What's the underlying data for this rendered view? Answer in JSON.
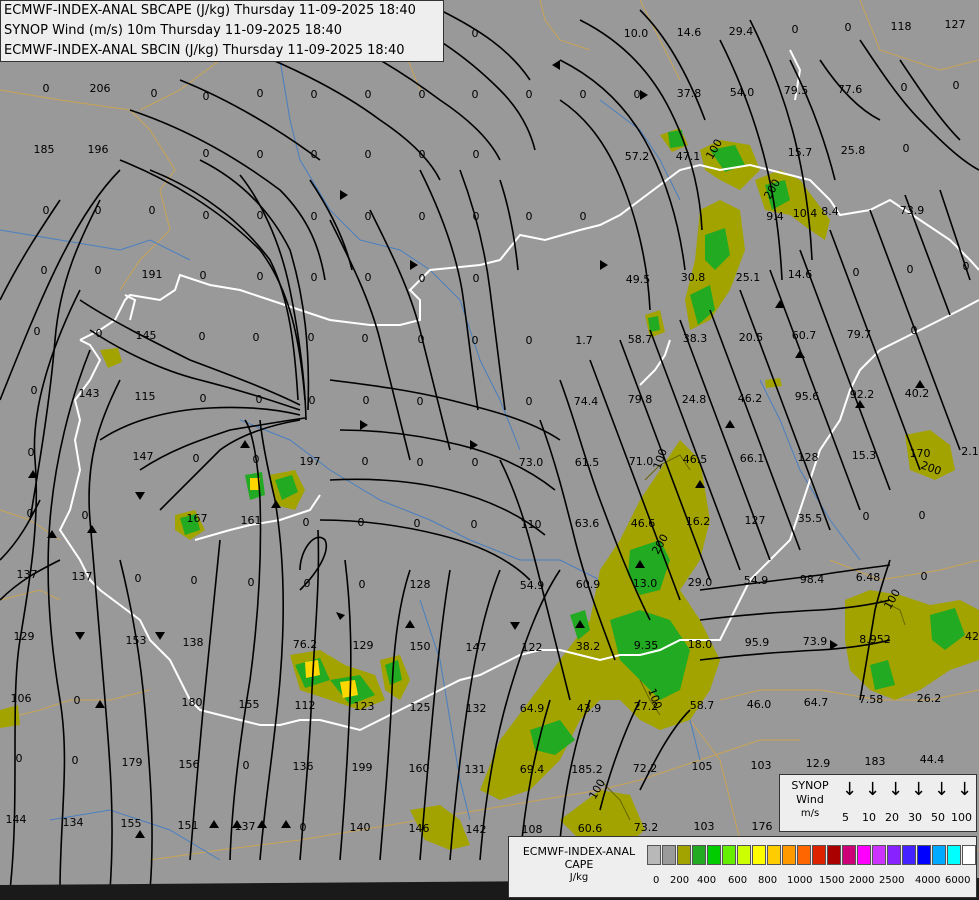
{
  "header": {
    "line1": "ECMWF-INDEX-ANAL SBCAPE (J/kg) Thursday 11-09-2025 18:40",
    "line2": "SYNOP Wind (m/s) 10m Thursday 11-09-2025 18:40",
    "line3": "ECMWF-INDEX-ANAL SBCIN (J/kg) Thursday 11-09-2025 18:40"
  },
  "colors": {
    "background": "#999999",
    "border": "#ffffff",
    "river": "#4a7fc0",
    "region_line": "#c9a455",
    "streamline": "#000000",
    "cape_low": "#a3a300",
    "cape_mid": "#22aa22",
    "cape_high": "#ffd700"
  },
  "values": [
    {
      "v": "0"
    },
    {
      "v": "206"
    },
    {
      "v": "0"
    },
    {
      "v": "0"
    },
    {
      "v": "0"
    },
    {
      "v": "0"
    },
    {
      "v": "0"
    },
    {
      "v": "0"
    },
    {
      "v": "0"
    },
    {
      "v": "0"
    },
    {
      "v": "0"
    },
    {
      "v": "0"
    },
    {
      "v": "185"
    },
    {
      "v": "196"
    },
    {
      "v": "0"
    },
    {
      "v": "0"
    },
    {
      "v": "0"
    },
    {
      "v": "0"
    },
    {
      "v": "0"
    },
    {
      "v": "0"
    },
    {
      "v": "57.2"
    },
    {
      "v": "47.1"
    },
    {
      "v": "15.7"
    },
    {
      "v": "25.8"
    },
    {
      "v": "0"
    },
    {
      "v": "0"
    },
    {
      "v": "0"
    },
    {
      "v": "0"
    },
    {
      "v": "0"
    },
    {
      "v": "0"
    },
    {
      "v": "0"
    },
    {
      "v": "0"
    },
    {
      "v": "0"
    },
    {
      "v": "0"
    },
    {
      "v": "0"
    },
    {
      "v": "0"
    },
    {
      "v": "8.4"
    },
    {
      "v": "10.4"
    },
    {
      "v": "9.4"
    },
    {
      "v": "73.9"
    },
    {
      "v": "0"
    },
    {
      "v": "0"
    },
    {
      "v": "191"
    },
    {
      "v": "0"
    },
    {
      "v": "0"
    },
    {
      "v": "0"
    },
    {
      "v": "0"
    },
    {
      "v": "0"
    },
    {
      "v": "0"
    },
    {
      "v": "49.5"
    },
    {
      "v": "30.8"
    },
    {
      "v": "25.1"
    },
    {
      "v": "14.6"
    },
    {
      "v": "0"
    },
    {
      "v": "0"
    },
    {
      "v": "0"
    },
    {
      "v": "0"
    },
    {
      "v": "0"
    },
    {
      "v": "145"
    },
    {
      "v": "0"
    },
    {
      "v": "0"
    },
    {
      "v": "0"
    },
    {
      "v": "0"
    },
    {
      "v": "0"
    },
    {
      "v": "0"
    },
    {
      "v": "0"
    },
    {
      "v": "1.7"
    },
    {
      "v": "58.7"
    },
    {
      "v": "38.3"
    },
    {
      "v": "20.5"
    },
    {
      "v": "60.7"
    },
    {
      "v": "79.7"
    },
    {
      "v": "0"
    },
    {
      "v": "0"
    },
    {
      "v": "143"
    },
    {
      "v": "115"
    },
    {
      "v": "0"
    },
    {
      "v": "0"
    },
    {
      "v": "0"
    },
    {
      "v": "0"
    },
    {
      "v": "0"
    },
    {
      "v": "0"
    },
    {
      "v": "74.4"
    },
    {
      "v": "79.8"
    },
    {
      "v": "24.8"
    },
    {
      "v": "46.2"
    },
    {
      "v": "95.6"
    },
    {
      "v": "92.2"
    },
    {
      "v": "40.2"
    },
    {
      "v": "0"
    },
    {
      "v": "147"
    },
    {
      "v": "0"
    },
    {
      "v": "0"
    },
    {
      "v": "197"
    },
    {
      "v": "0"
    },
    {
      "v": "0"
    },
    {
      "v": "0"
    },
    {
      "v": "73.0"
    },
    {
      "v": "61.5"
    },
    {
      "v": "71.0"
    },
    {
      "v": "46.5"
    },
    {
      "v": "66.1"
    },
    {
      "v": "128"
    },
    {
      "v": "15.3"
    },
    {
      "v": "170"
    },
    {
      "v": "2.1"
    },
    {
      "v": "0"
    },
    {
      "v": "0"
    },
    {
      "v": "167"
    },
    {
      "v": "161"
    },
    {
      "v": "0"
    },
    {
      "v": "0"
    },
    {
      "v": "0"
    },
    {
      "v": "0"
    },
    {
      "v": "110"
    },
    {
      "v": "63.6"
    },
    {
      "v": "46.6"
    },
    {
      "v": "16.2"
    },
    {
      "v": "127"
    },
    {
      "v": "35.5"
    },
    {
      "v": "0"
    },
    {
      "v": "0"
    },
    {
      "v": "137"
    },
    {
      "v": "137"
    },
    {
      "v": "0"
    },
    {
      "v": "0"
    },
    {
      "v": "0"
    },
    {
      "v": "0"
    },
    {
      "v": "0"
    },
    {
      "v": "128"
    },
    {
      "v": "54.9"
    },
    {
      "v": "60.9"
    },
    {
      "v": "13.0"
    },
    {
      "v": "29.0"
    },
    {
      "v": "54.9"
    },
    {
      "v": "98.4"
    },
    {
      "v": "6.48"
    },
    {
      "v": "0"
    },
    {
      "v": "129"
    },
    {
      "v": "153"
    },
    {
      "v": "138"
    },
    {
      "v": "76.2"
    },
    {
      "v": "129"
    },
    {
      "v": "150"
    },
    {
      "v": "147"
    },
    {
      "v": "122"
    },
    {
      "v": "38.2"
    },
    {
      "v": "9.35"
    },
    {
      "v": "18.0"
    },
    {
      "v": "95.9"
    },
    {
      "v": "73.9"
    },
    {
      "v": "8.952"
    },
    {
      "v": "42"
    },
    {
      "v": "106"
    },
    {
      "v": "0"
    },
    {
      "v": "180"
    },
    {
      "v": "155"
    },
    {
      "v": "112"
    },
    {
      "v": "123"
    },
    {
      "v": "125"
    },
    {
      "v": "132"
    },
    {
      "v": "64.9"
    },
    {
      "v": "43.9"
    },
    {
      "v": "27.2"
    },
    {
      "v": "58.7"
    },
    {
      "v": "46.0"
    },
    {
      "v": "64.7"
    },
    {
      "v": "7.58"
    },
    {
      "v": "26.2"
    },
    {
      "v": "0"
    },
    {
      "v": "0"
    },
    {
      "v": "179"
    },
    {
      "v": "156"
    },
    {
      "v": "0"
    },
    {
      "v": "136"
    },
    {
      "v": "199"
    },
    {
      "v": "160"
    },
    {
      "v": "131"
    },
    {
      "v": "69.4"
    },
    {
      "v": "185.2"
    },
    {
      "v": "72.2"
    },
    {
      "v": "105"
    },
    {
      "v": "103"
    },
    {
      "v": "12.9"
    },
    {
      "v": "183"
    },
    {
      "v": "44.4"
    },
    {
      "v": "144"
    },
    {
      "v": "134"
    },
    {
      "v": "155"
    },
    {
      "v": "151"
    },
    {
      "v": "137"
    },
    {
      "v": "0"
    },
    {
      "v": "140"
    },
    {
      "v": "146"
    },
    {
      "v": "142"
    },
    {
      "v": "108"
    },
    {
      "v": "60.6"
    },
    {
      "v": "73.2"
    },
    {
      "v": "103"
    },
    {
      "v": "176"
    },
    {
      "v": "109"
    },
    {
      "v": "0"
    },
    {
      "v": "0"
    },
    {
      "v": "10.0"
    },
    {
      "v": "14.6"
    },
    {
      "v": "29.4"
    },
    {
      "v": "0"
    },
    {
      "v": "0"
    },
    {
      "v": "118"
    },
    {
      "v": "127"
    },
    {
      "v": "37.8"
    },
    {
      "v": "54.0"
    },
    {
      "v": "79.5"
    },
    {
      "v": "77.6"
    },
    {
      "v": "0"
    },
    {
      "v": "0"
    },
    {
      "v": "0"
    },
    {
      "v": "0"
    },
    {
      "v": "0"
    },
    {
      "v": "0"
    },
    {
      "v": "0"
    },
    {
      "v": "0"
    }
  ],
  "contour_labels": [
    "100",
    "200",
    "100",
    "200",
    "100",
    "100",
    "100",
    "200"
  ],
  "wind_key": {
    "title_lines": [
      "SYNOP",
      "Wind",
      "m/s"
    ],
    "arrow_glyph": "↓",
    "speeds": [
      "5",
      "10",
      "20",
      "30",
      "50",
      "100"
    ]
  },
  "legend": {
    "title_lines": [
      "ECMWF-INDEX-ANAL",
      "CAPE",
      "J/kg"
    ],
    "colors": [
      "#b8b8b8",
      "#9a9a9a",
      "#a3a300",
      "#22aa22",
      "#00cc00",
      "#66ee00",
      "#ccff00",
      "#ffff00",
      "#ffcc00",
      "#ff9900",
      "#ff6600",
      "#dd2200",
      "#aa0000",
      "#cc0077",
      "#ff00ff",
      "#cc33ff",
      "#8822ff",
      "#4422ff",
      "#0000ff",
      "#00aaff",
      "#00ffff",
      "#ffffff"
    ],
    "labels": [
      "0",
      "200",
      "400",
      "600",
      "800",
      "1000",
      "1500",
      "2000",
      "2500",
      "4000",
      "6000"
    ]
  }
}
